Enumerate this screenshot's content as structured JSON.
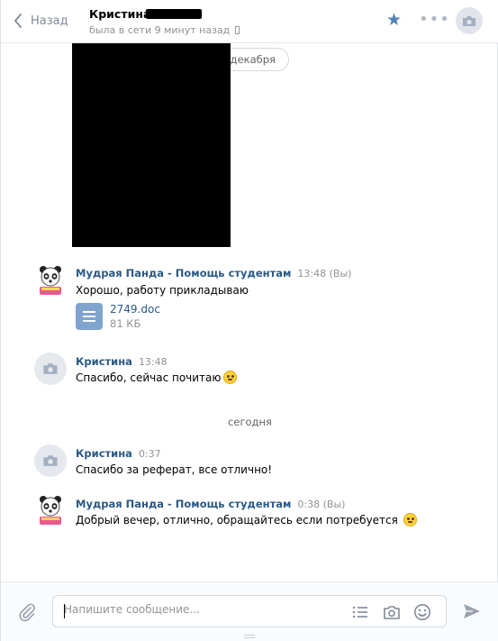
{
  "header": {
    "back_label": "Назад",
    "peer_name": "Кристина",
    "peer_status": "была в сети 9 минут назад"
  },
  "thread": {
    "date_pill": "декабря",
    "day_separator": "сегодня",
    "messages": [
      {
        "author": "Мудрая Панда - Помощь студентам",
        "time": "13:48 (Вы)",
        "text": "Хорошо, работу прикладываю",
        "attachment": {
          "name": "2749.doc",
          "size": "81 КБ"
        }
      },
      {
        "author": "Кристина",
        "time": "13:48",
        "text": "Спасибо, сейчас почитаю"
      },
      {
        "author": "Кристина",
        "time": "0:37",
        "text": "Спасибо за реферат, все отлично!"
      },
      {
        "author": "Мудрая Панда - Помощь студентам",
        "time": "0:38 (Вы)",
        "text": "Добрый вечер, отлично, обращайтесь если потребуется"
      }
    ]
  },
  "composer": {
    "placeholder": "Напишите сообщение..."
  },
  "colors": {
    "accent": "#5181b8",
    "link": "#2a5885",
    "muted": "#939393"
  },
  "icons": [
    "chevron-left-icon",
    "phone-icon",
    "star-icon",
    "more-dots-icon",
    "camera-icon",
    "document-icon",
    "emoji-icon",
    "paperclip-icon",
    "list-icon",
    "smile-icon",
    "send-icon"
  ]
}
